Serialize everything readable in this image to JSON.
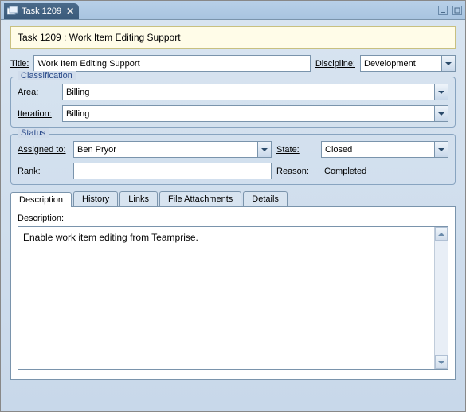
{
  "header": {
    "tab_title": "Task 1209"
  },
  "banner": "Task 1209 : Work Item Editing Support",
  "fields": {
    "title_label": "Title:",
    "title_value": "Work Item Editing Support",
    "discipline_label": "Discipline:",
    "discipline_value": "Development"
  },
  "classification": {
    "legend": "Classification",
    "area_label": "Area:",
    "area_value": "Billing",
    "iteration_label": "Iteration:",
    "iteration_value": "Billing"
  },
  "status": {
    "legend": "Status",
    "assigned_label": "Assigned to:",
    "assigned_value": "Ben Pryor",
    "state_label": "State:",
    "state_value": "Closed",
    "rank_label": "Rank:",
    "rank_value": "",
    "reason_label": "Reason:",
    "reason_value": "Completed"
  },
  "tabs": {
    "description": "Description",
    "history": "History",
    "links": "Links",
    "file_attachments": "File Attachments",
    "details": "Details"
  },
  "description": {
    "label": "Description:",
    "value": "Enable work item editing from Teamprise."
  }
}
